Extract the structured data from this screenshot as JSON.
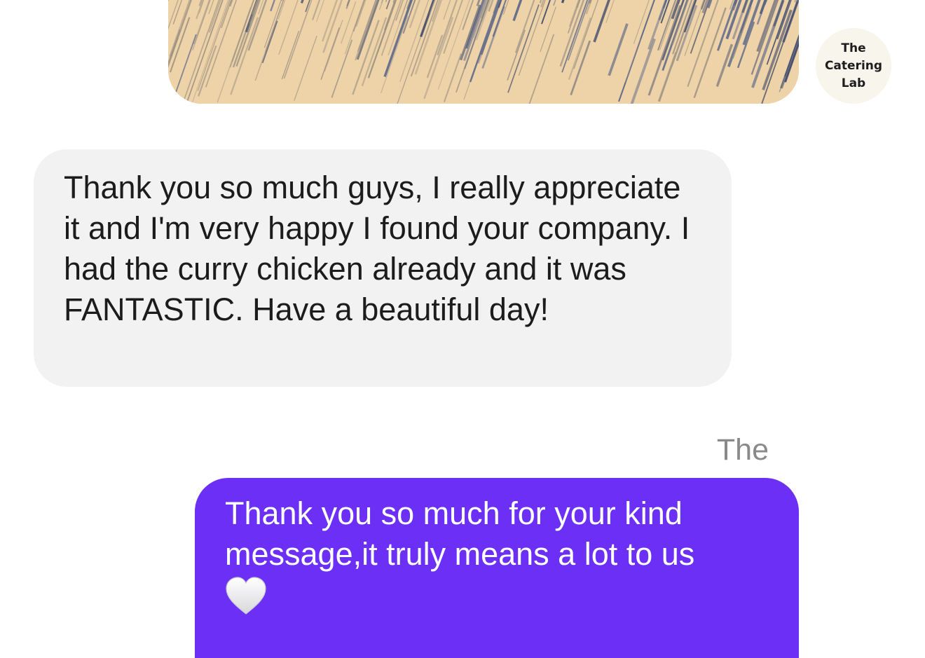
{
  "thread": {
    "image_message": {
      "kind": "photo",
      "icon": "striped-photo"
    },
    "avatar": {
      "label": "The\nCatering\nLab",
      "bg_color": "#f8f5ed"
    },
    "incoming_message": {
      "text": "Thank you so much guys, I really appreciate it and I'm very happy I found your company. I had the curry chicken already and it was FANTASTIC. Have a beautiful day!",
      "bubble_color": "#f2f2f2"
    },
    "sender_label": "The",
    "outgoing_message": {
      "text": "Thank you so much for your kind message,it truly means a lot to us",
      "emoji_icon": "white-heart-icon",
      "bubble_color": "#6b2ff5"
    }
  }
}
